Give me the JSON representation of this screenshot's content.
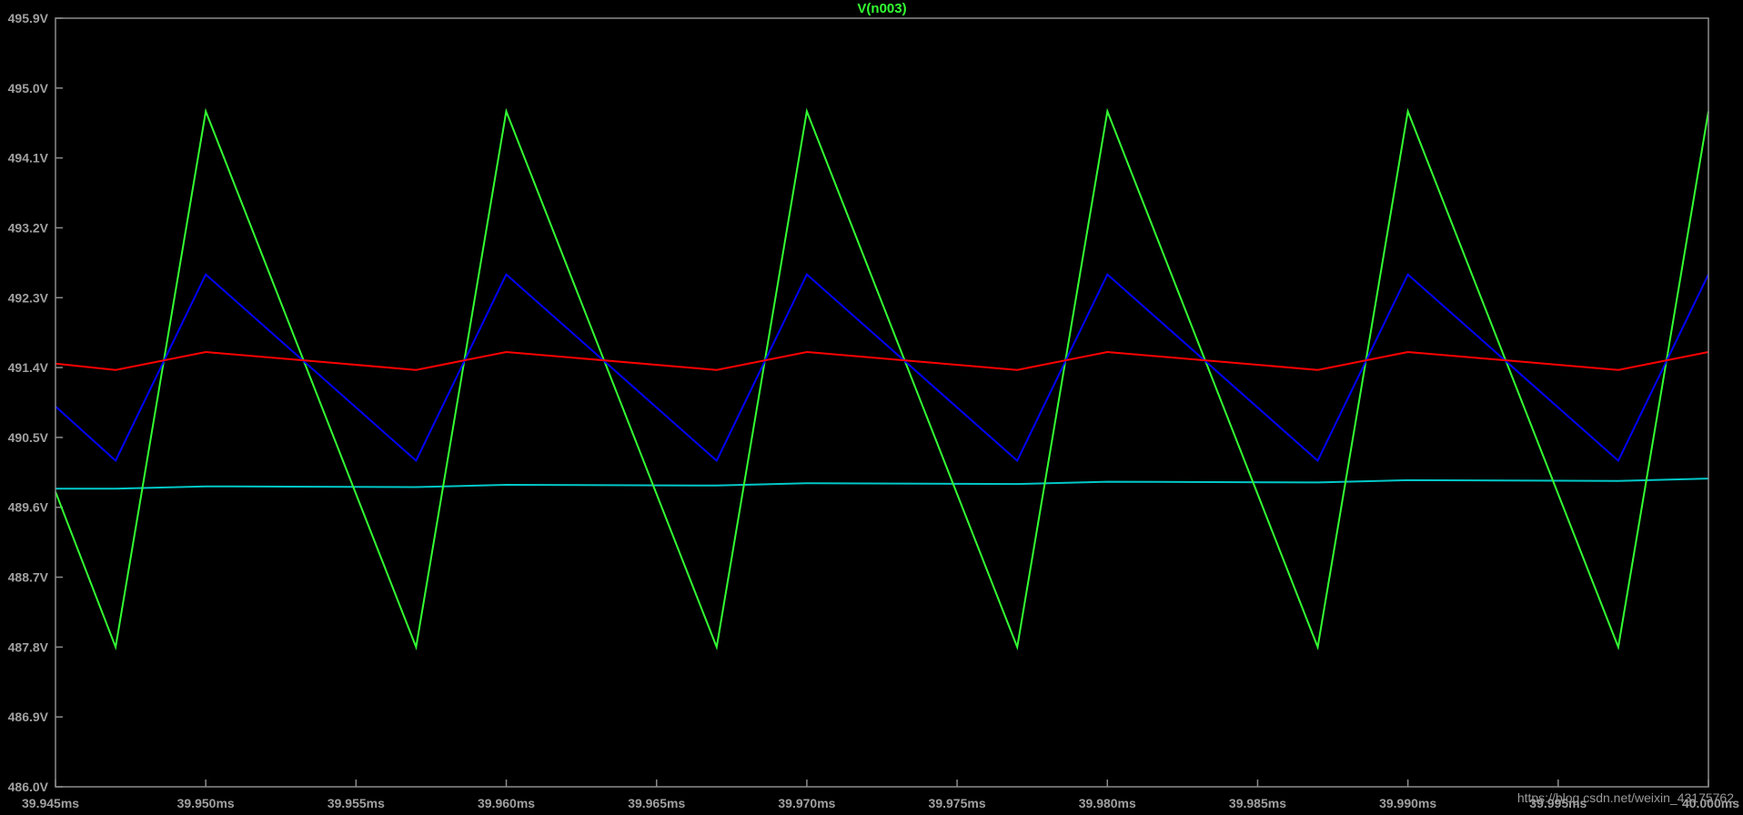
{
  "chart_data": {
    "type": "line",
    "title": "V(n003)",
    "xlabel": "",
    "ylabel": "",
    "xlim": [
      39.945,
      40.0
    ],
    "ylim": [
      486.0,
      495.9
    ],
    "x_ticks": [
      "39.945ms",
      "39.950ms",
      "39.955ms",
      "39.960ms",
      "39.965ms",
      "39.970ms",
      "39.975ms",
      "39.980ms",
      "39.985ms",
      "39.990ms",
      "39.995ms",
      "40.000ms"
    ],
    "x_tick_values": [
      39.945,
      39.95,
      39.955,
      39.96,
      39.965,
      39.97,
      39.975,
      39.98,
      39.985,
      39.99,
      39.995,
      40.0
    ],
    "y_ticks": [
      "495.9V",
      "495.0V",
      "494.1V",
      "493.2V",
      "492.3V",
      "491.4V",
      "490.5V",
      "489.6V",
      "488.7V",
      "487.8V",
      "486.9V",
      "486.0V"
    ],
    "y_tick_values": [
      495.9,
      495.0,
      494.1,
      493.2,
      492.3,
      491.4,
      490.5,
      489.6,
      488.7,
      487.8,
      486.9,
      486.0
    ],
    "grid": false,
    "series": [
      {
        "name": "V(n003)",
        "color": "#33ff33",
        "x": [
          39.945,
          39.947,
          39.95,
          39.957,
          39.96,
          39.967,
          39.97,
          39.977,
          39.98,
          39.987,
          39.99,
          39.997,
          40.0
        ],
        "y": [
          489.8,
          487.8,
          494.7,
          487.8,
          494.7,
          487.8,
          494.7,
          487.8,
          494.7,
          487.8,
          494.7,
          487.8,
          494.7
        ]
      },
      {
        "color": "#0000ff",
        "x": [
          39.945,
          39.947,
          39.95,
          39.957,
          39.96,
          39.967,
          39.97,
          39.977,
          39.98,
          39.987,
          39.99,
          39.997,
          40.0
        ],
        "y": [
          490.9,
          490.2,
          492.6,
          490.2,
          492.6,
          490.2,
          492.6,
          490.2,
          492.6,
          490.2,
          492.6,
          490.2,
          492.6
        ]
      },
      {
        "color": "#ff0000",
        "x": [
          39.945,
          39.947,
          39.95,
          39.957,
          39.96,
          39.967,
          39.97,
          39.977,
          39.98,
          39.987,
          39.99,
          39.997,
          40.0
        ],
        "y": [
          491.45,
          491.37,
          491.6,
          491.37,
          491.6,
          491.37,
          491.6,
          491.37,
          491.6,
          491.37,
          491.6,
          491.37,
          491.6
        ]
      },
      {
        "color": "#00c8c8",
        "x": [
          39.945,
          39.947,
          39.95,
          39.957,
          39.96,
          39.967,
          39.97,
          39.977,
          39.98,
          39.987,
          39.99,
          39.997,
          40.0
        ],
        "y": [
          489.84,
          489.84,
          489.87,
          489.86,
          489.89,
          489.88,
          489.91,
          489.9,
          489.93,
          489.92,
          489.95,
          489.94,
          489.97
        ]
      }
    ]
  },
  "watermark": "https://blog.csdn.net/weixin_43175762",
  "colors": {
    "background": "#000000",
    "axis": "#8c8c8c",
    "tick_text": "#a0a0a0",
    "title": "#33ff33"
  }
}
